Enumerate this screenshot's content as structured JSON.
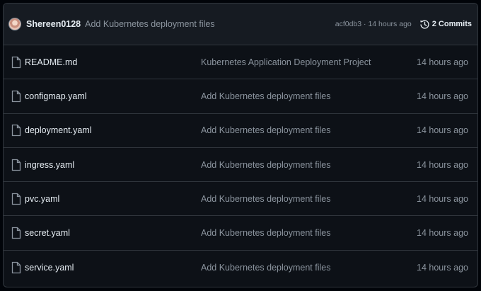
{
  "latest_commit": {
    "author": "Shereen0128",
    "message": "Add Kubernetes deployment files",
    "sha_time": "acf0db3 · 14 hours ago",
    "commits_label": "2 Commits"
  },
  "files": [
    {
      "name": "README.md",
      "message": "Kubernetes Application Deployment Project",
      "time": "14 hours ago"
    },
    {
      "name": "configmap.yaml",
      "message": "Add Kubernetes deployment files",
      "time": "14 hours ago"
    },
    {
      "name": "deployment.yaml",
      "message": "Add Kubernetes deployment files",
      "time": "14 hours ago"
    },
    {
      "name": "ingress.yaml",
      "message": "Add Kubernetes deployment files",
      "time": "14 hours ago"
    },
    {
      "name": "pvc.yaml",
      "message": "Add Kubernetes deployment files",
      "time": "14 hours ago"
    },
    {
      "name": "secret.yaml",
      "message": "Add Kubernetes deployment files",
      "time": "14 hours ago"
    },
    {
      "name": "service.yaml",
      "message": "Add Kubernetes deployment files",
      "time": "14 hours ago"
    }
  ],
  "icons": {
    "file": "file-icon",
    "history": "history-icon",
    "avatar": "avatar"
  },
  "colors": {
    "background": "#0d1117",
    "header": "#161b22",
    "border": "#30363d",
    "text": "#e6edf3",
    "muted": "#8b949e"
  }
}
